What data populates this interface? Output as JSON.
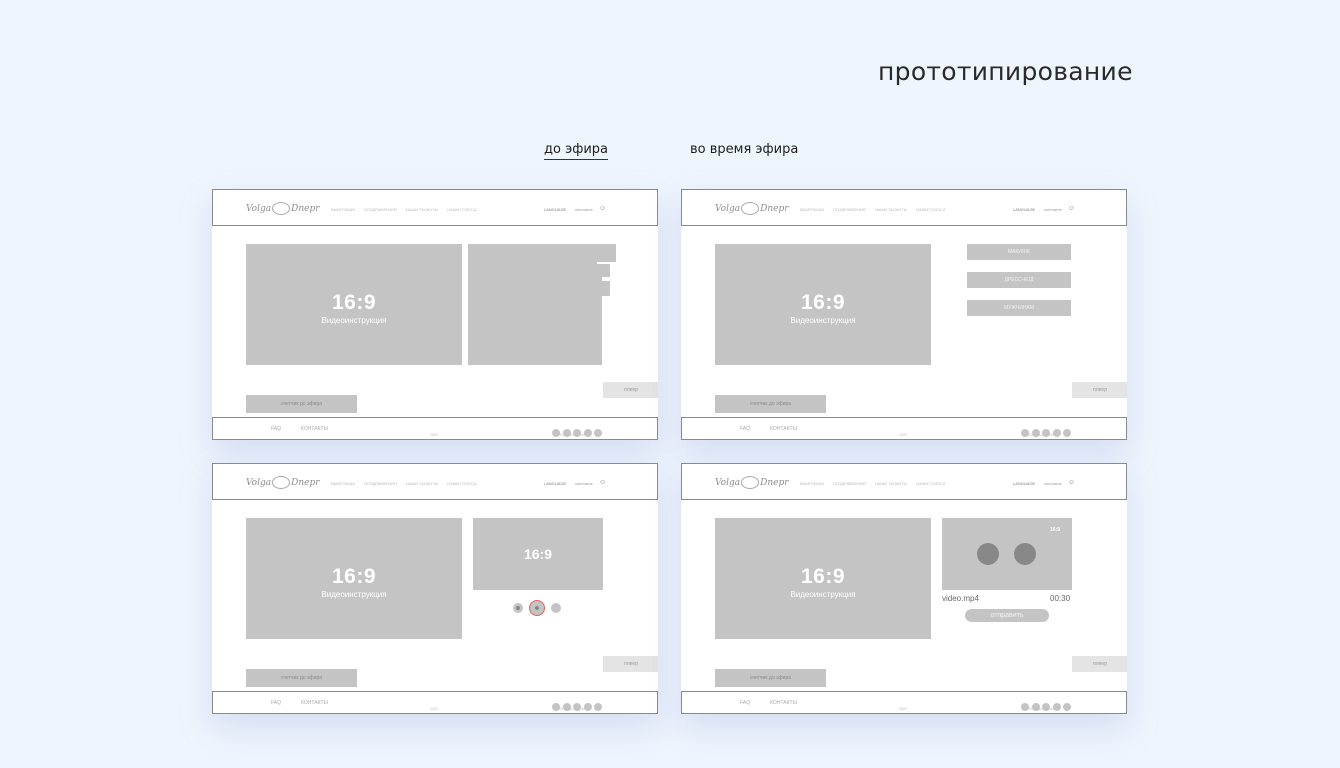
{
  "title": "прототипирование",
  "tabs": [
    {
      "label": "до эфира",
      "active": true
    },
    {
      "label": "во время эфира",
      "active": false
    }
  ],
  "site": {
    "logo_left": "Volga",
    "logo_right": "Dnepr",
    "nav": [
      "выигрыши",
      "поздравления",
      "наши таланты",
      "наши голоса"
    ],
    "language": "LANGUAGE",
    "account": "username",
    "video_ratio": "16:9",
    "video_label": "Видеоинструкция",
    "counter_label": "счетчик до эфира",
    "player_label": "плеер",
    "footer_links": [
      "FAQ",
      "КОНТАКТЫ"
    ],
    "footer_year": "2020",
    "social_label": "SOCIAL ICON"
  },
  "frame2": {
    "buttons": [
      "макияж",
      "дресс-код",
      "мужчинам"
    ]
  },
  "frame3": {
    "mini_ratio": "16:9"
  },
  "frame4": {
    "cam_ratio": "16:9",
    "file_name": "video.mp4",
    "file_time": "00:30",
    "send_label": "отправить"
  },
  "colors": {
    "background": "#eef5fd",
    "placeholder": "#c4c4c4",
    "border": "#8a8a8a"
  }
}
